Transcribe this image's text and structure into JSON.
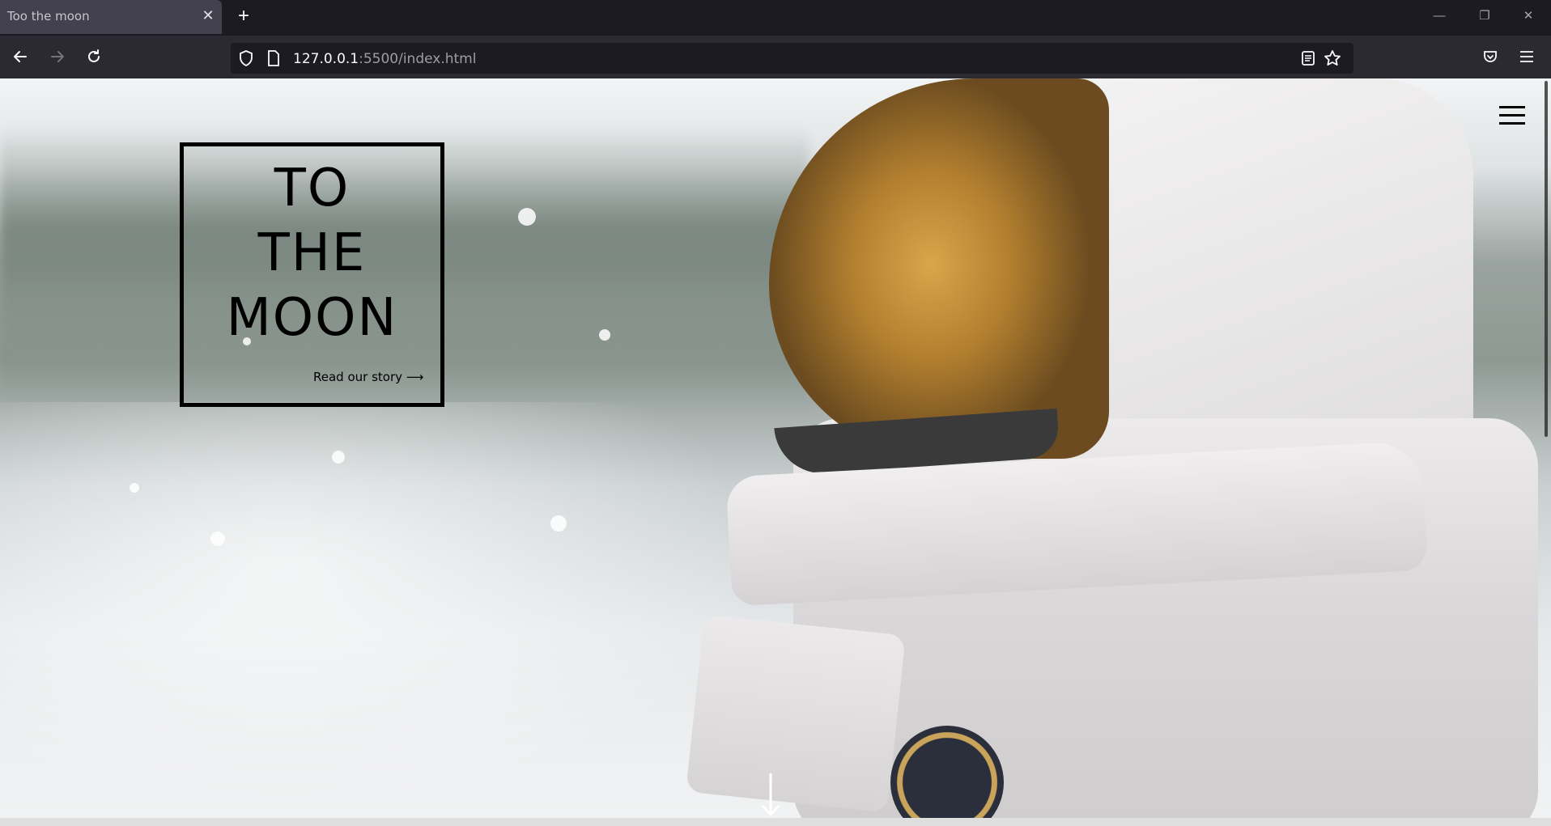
{
  "browser": {
    "tab_title": "Too the moon",
    "tab_close": "✕",
    "new_tab": "+",
    "url_host": "127.0.0.1",
    "url_rest": ":5500/index.html",
    "window_controls": {
      "minimize": "—",
      "restore": "❐",
      "close": "✕"
    }
  },
  "hero": {
    "title_line1": "TO",
    "title_line2": "THE",
    "title_line3": "MOON",
    "cta": "Read our story ⟶"
  },
  "icons": {
    "back": "back-arrow-icon",
    "forward": "forward-arrow-icon",
    "reload": "reload-icon",
    "shield": "tracking-shield-icon",
    "page": "page-info-icon",
    "reader": "reader-view-icon",
    "bookmark": "bookmark-star-icon",
    "pocket": "pocket-icon",
    "menu": "app-menu-icon",
    "site_menu": "hamburger-icon",
    "scroll": "scroll-down-arrow-icon"
  },
  "colors": {
    "browser_bg": "#1c1b22",
    "toolbar_bg": "#2b2a33",
    "tab_active": "#42414d",
    "hero_text": "#000000"
  }
}
